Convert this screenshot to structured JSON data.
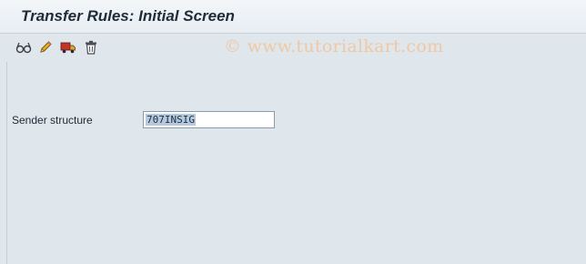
{
  "screen": {
    "title": "Transfer Rules: Initial Screen"
  },
  "toolbar": {
    "items": [
      {
        "icon": "display-glasses-icon"
      },
      {
        "icon": "change-pencil-icon"
      },
      {
        "icon": "create-truck-icon"
      },
      {
        "icon": "delete-trash-icon"
      }
    ]
  },
  "watermark": "© www.tutorialkart.com",
  "form": {
    "sender_structure": {
      "label": "Sender structure",
      "value": "707INSIG"
    }
  }
}
